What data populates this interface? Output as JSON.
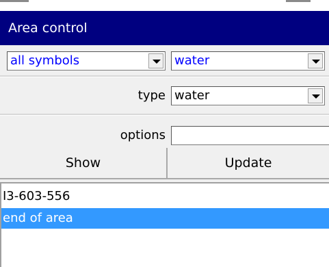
{
  "window": {
    "title": "Area control"
  },
  "filter": {
    "symbol_scope": "all symbols",
    "symbol_name": "water"
  },
  "type_row": {
    "label": "type",
    "value": "water"
  },
  "options_row": {
    "label": "options",
    "value": ""
  },
  "buttons": {
    "show": "Show",
    "update": "Update"
  },
  "list": {
    "items": [
      {
        "text": "I3-603-556",
        "selected": false
      },
      {
        "text": "end of area",
        "selected": true
      }
    ]
  },
  "colors": {
    "titlebar": "#000080",
    "selection": "#3399ff",
    "combo_text_blue": "#0000ff"
  }
}
